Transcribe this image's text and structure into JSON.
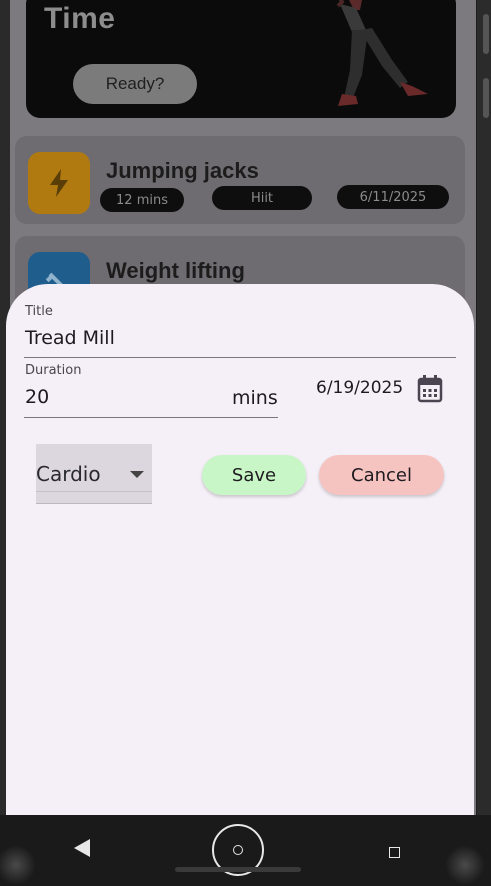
{
  "hero": {
    "title": "Time",
    "ready_label": "Ready?"
  },
  "workouts": [
    {
      "title": "Jumping jacks",
      "duration": "12 mins",
      "category": "Hiit",
      "date": "6/11/2025",
      "icon": "lightning-icon",
      "icon_color": "#b07a10"
    },
    {
      "title": "Weight lifting",
      "icon": "dumbbell-icon",
      "icon_color": "#1f5d8c"
    }
  ],
  "form": {
    "title_label": "Title",
    "title_value": "Tread Mill",
    "duration_label": "Duration",
    "duration_value": "20",
    "duration_unit": "mins",
    "date_value": "6/19/2025",
    "category_value": "Cardio",
    "save_label": "Save",
    "cancel_label": "Cancel"
  },
  "colors": {
    "save_bg": "#c9f6c6",
    "cancel_bg": "#f6c4c0",
    "sheet_bg": "#f5eff7"
  },
  "navbar": {
    "back_icon": "back-triangle-icon",
    "home_icon": "home-circle-icon",
    "recents_icon": "recents-square-icon"
  }
}
